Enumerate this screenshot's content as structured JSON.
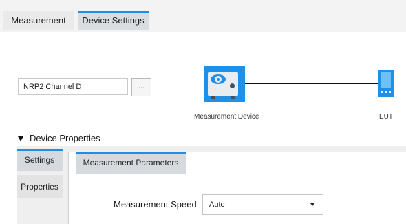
{
  "tabs": [
    {
      "label": "Measurement",
      "active": false
    },
    {
      "label": "Device Settings",
      "active": true
    }
  ],
  "device_selector": {
    "value": "NRP2 Channel D",
    "browse_label": "..."
  },
  "diagram": {
    "measurement_device_label": "Measurement Device",
    "eut_label": "EUT"
  },
  "device_properties": {
    "header": "Device Properties",
    "side_tabs": [
      {
        "label": "Settings",
        "selected": true
      },
      {
        "label": "Properties",
        "selected": false
      }
    ],
    "content_tab": "Measurement Parameters",
    "fields": {
      "measurement_speed": {
        "label": "Measurement Speed",
        "value": "Auto"
      }
    }
  },
  "colors": {
    "accent": "#1f8fe6",
    "icon_blue": "#1f90e8"
  }
}
